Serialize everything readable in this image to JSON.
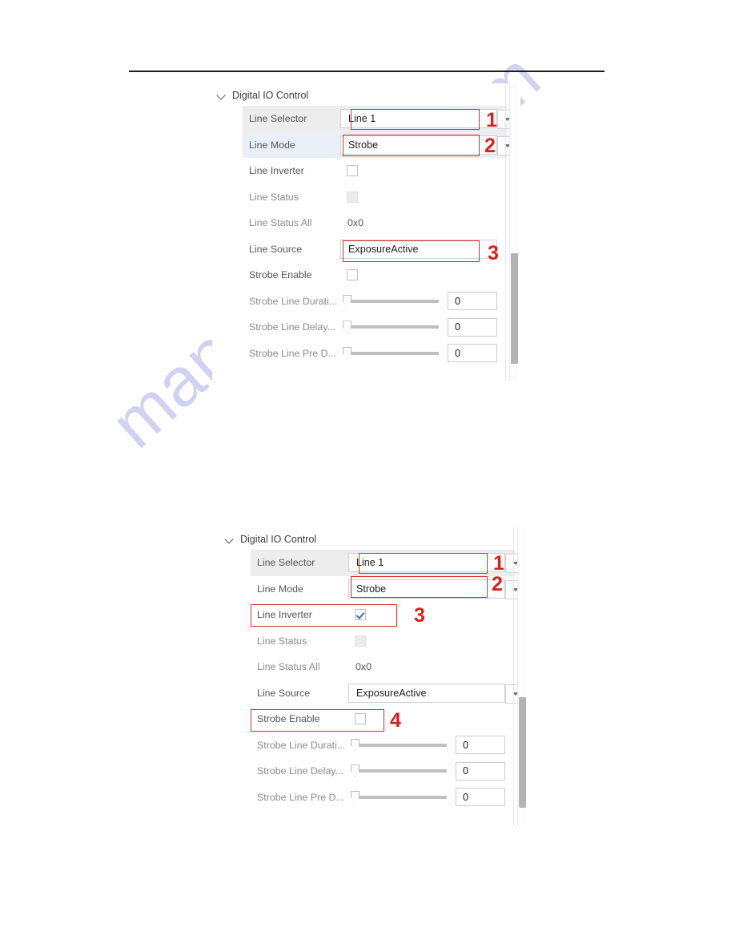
{
  "document": {
    "watermark_text": "manualshive.com",
    "rule_color": "#1a1a1a",
    "annotation_color": "#e02b28"
  },
  "figures": [
    {
      "id": "figure-1",
      "group_title": "Digital IO Control",
      "chevron_icon": "chevron-down-icon",
      "rows": [
        {
          "label": "Line Selector",
          "type": "combo",
          "value": "Line 1",
          "highlight": "gray",
          "arrow": true
        },
        {
          "label": "Line Mode",
          "type": "combo",
          "value": "Strobe",
          "highlight": "blue",
          "arrow": true
        },
        {
          "label": "Line Inverter",
          "type": "checkbox",
          "value": "unchecked",
          "highlight": "none"
        },
        {
          "label": "Line Status",
          "type": "checkbox",
          "value": "disabled",
          "highlight": "none",
          "dim": true
        },
        {
          "label": "Line Status All",
          "type": "text",
          "value": "0x0",
          "highlight": "none",
          "dim": true
        },
        {
          "label": "Line Source",
          "type": "combo",
          "value": "ExposureActive",
          "highlight": "none",
          "arrow": false
        },
        {
          "label": "Strobe Enable",
          "type": "checkbox",
          "value": "unchecked",
          "highlight": "none"
        },
        {
          "label": "Strobe Line Durati...",
          "type": "slider",
          "value": "0",
          "highlight": "none"
        },
        {
          "label": "Strobe Line Delay...",
          "type": "slider",
          "value": "0",
          "highlight": "none"
        },
        {
          "label": "Strobe Line Pre D...",
          "type": "slider",
          "value": "0",
          "highlight": "none"
        }
      ],
      "annotations": [
        {
          "number": "1",
          "target": "line-selector-combo"
        },
        {
          "number": "2",
          "target": "line-mode-combo"
        },
        {
          "number": "3",
          "target": "line-source-combo"
        }
      ]
    },
    {
      "id": "figure-2",
      "group_title": "Digital IO Control",
      "chevron_icon": "chevron-down-icon",
      "rows": [
        {
          "label": "Line Selector",
          "type": "combo",
          "value": "Line 1",
          "highlight": "gray",
          "arrow": true
        },
        {
          "label": "Line Mode",
          "type": "combo",
          "value": "Strobe",
          "highlight": "none",
          "arrow": true
        },
        {
          "label": "Line Inverter",
          "type": "checkbox",
          "value": "checked",
          "highlight": "none"
        },
        {
          "label": "Line Status",
          "type": "checkbox",
          "value": "disabled",
          "highlight": "none",
          "dim": true
        },
        {
          "label": "Line Status All",
          "type": "text",
          "value": "0x0",
          "highlight": "none",
          "dim": true
        },
        {
          "label": "Line Source",
          "type": "combo",
          "value": "ExposureActive",
          "highlight": "none",
          "arrow": true
        },
        {
          "label": "Strobe Enable",
          "type": "checkbox",
          "value": "unchecked",
          "highlight": "none"
        },
        {
          "label": "Strobe Line Durati...",
          "type": "slider",
          "value": "0",
          "highlight": "none"
        },
        {
          "label": "Strobe Line Delay...",
          "type": "slider",
          "value": "0",
          "highlight": "none"
        },
        {
          "label": "Strobe Line Pre D...",
          "type": "slider",
          "value": "0",
          "highlight": "none"
        }
      ],
      "annotations": [
        {
          "number": "1",
          "target": "line-selector-combo"
        },
        {
          "number": "2",
          "target": "line-mode-combo"
        },
        {
          "number": "3",
          "target": "line-inverter-row"
        },
        {
          "number": "4",
          "target": "strobe-enable-row"
        }
      ]
    }
  ]
}
